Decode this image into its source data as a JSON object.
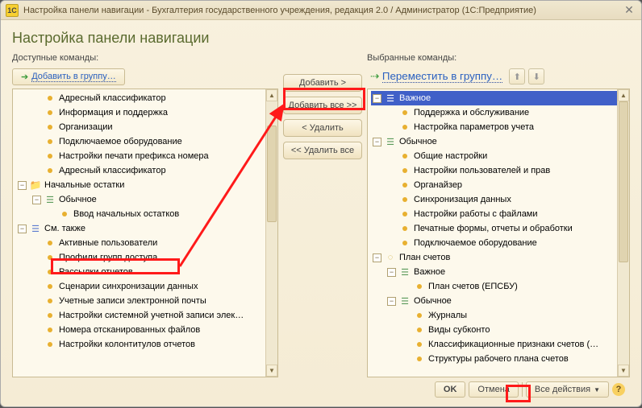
{
  "titlebar": {
    "app_icon": "1C",
    "title": "Настройка панели навигации - Бухгалтерия государственного учреждения, редакция 2.0 / Администратор  (1С:Предприятие)"
  },
  "page_title": "Настройка панели навигации",
  "left": {
    "label": "Доступные команды:",
    "add_group": "Добавить в группу…"
  },
  "right": {
    "label": "Выбранные команды:",
    "move_group": "Переместить в группу…"
  },
  "mid": {
    "add": "Добавить >",
    "add_all": "Добавить все >>",
    "remove": "< Удалить",
    "remove_all": "<< Удалить все"
  },
  "left_tree": {
    "n0": "Адресный классификатор",
    "n1": "Информация и поддержка",
    "n2": "Организации",
    "n3": "Подключаемое оборудование",
    "n4": "Настройки печати префикса номера",
    "n5": "Адресный классификатор",
    "g1": "Начальные остатки",
    "g1a": "Обычное",
    "g1a1": "Ввод начальных остатков",
    "g2": "См. также",
    "g2a": "Активные пользователи",
    "g2b": "Профили групп доступа",
    "g2c": "Рассылки отчетов",
    "g2d": "Сценарии синхронизации данных",
    "g2e": "Учетные записи электронной почты",
    "g2f": "Настройки системной учетной записи элек…",
    "g2g": "Номера отсканированных файлов",
    "g2h": "Настройки колонтитулов отчетов"
  },
  "right_tree": {
    "r0": "Важное",
    "r0a": "Поддержка и обслуживание",
    "r0b": "Настройка параметров учета",
    "r1": "Обычное",
    "r1a": "Общие настройки",
    "r1b": "Настройки пользователей и прав",
    "r1c": "Органайзер",
    "r1d": "Синхронизация данных",
    "r1e": "Настройки работы с файлами",
    "r1f": "Печатные формы, отчеты и обработки",
    "r1g": "Подключаемое оборудование",
    "r2": "План счетов",
    "r2a": "Важное",
    "r2a1": "План счетов (ЕПСБУ)",
    "r2b": "Обычное",
    "r2b1": "Журналы",
    "r2b2": "Виды субконто",
    "r2b3": "Классификационные признаки счетов (…",
    "r2b4": "Структуры рабочего плана счетов"
  },
  "footer": {
    "ok": "OK",
    "cancel": "Отмена",
    "actions": "Все действия"
  }
}
